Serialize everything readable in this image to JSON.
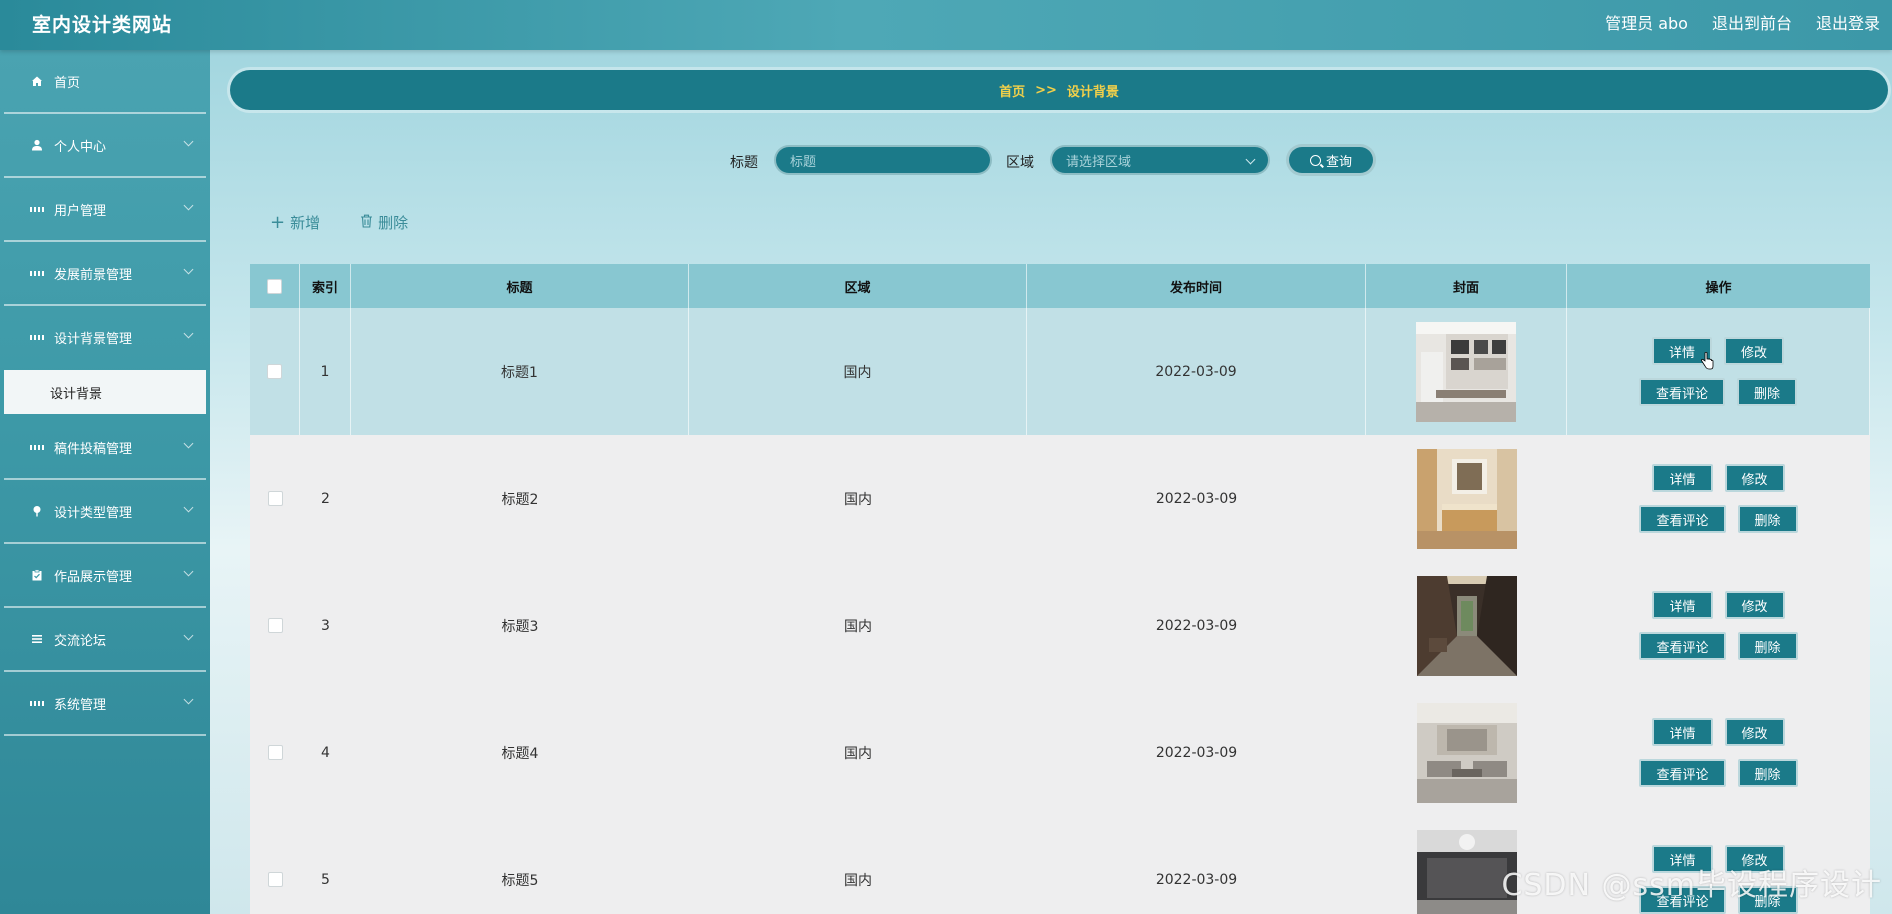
{
  "header": {
    "brand": "室内设计类网站",
    "admin": "管理员 abo",
    "to_front": "退出到前台",
    "logout": "退出登录"
  },
  "sidebar": {
    "items": [
      {
        "label": "首页",
        "icon": "home-icon"
      },
      {
        "label": "个人中心",
        "icon": "user-icon"
      },
      {
        "label": "用户管理",
        "icon": "grid-icon"
      },
      {
        "label": "发展前景管理",
        "icon": "grid-icon"
      },
      {
        "label": "设计背景管理",
        "icon": "grid-icon"
      },
      {
        "label": "稿件投稿管理",
        "icon": "grid-icon"
      },
      {
        "label": "设计类型管理",
        "icon": "pin-icon"
      },
      {
        "label": "作品展示管理",
        "icon": "clipboard-icon"
      },
      {
        "label": "交流论坛",
        "icon": "list-icon"
      },
      {
        "label": "系统管理",
        "icon": "grid-icon"
      }
    ],
    "sub_active": "设计背景"
  },
  "breadcrumb": {
    "home": "首页",
    "sep": ">>",
    "current": "设计背景"
  },
  "search": {
    "title_label": "标题",
    "title_placeholder": "标题",
    "area_label": "区域",
    "area_placeholder": "请选择区域",
    "query": "查询"
  },
  "toolbar": {
    "add": "新增",
    "delete": "删除"
  },
  "table": {
    "headers": {
      "index": "索引",
      "title": "标题",
      "area": "区域",
      "time": "发布时间",
      "cover": "封面",
      "ops": "操作"
    },
    "rows": [
      {
        "index": "1",
        "title": "标题1",
        "area": "国内",
        "time": "2022-03-09"
      },
      {
        "index": "2",
        "title": "标题2",
        "area": "国内",
        "time": "2022-03-09"
      },
      {
        "index": "3",
        "title": "标题3",
        "area": "国内",
        "time": "2022-03-09"
      },
      {
        "index": "4",
        "title": "标题4",
        "area": "国内",
        "time": "2022-03-09"
      },
      {
        "index": "5",
        "title": "标题5",
        "area": "国内",
        "time": "2022-03-09"
      }
    ],
    "ops": {
      "detail": "详情",
      "edit": "修改",
      "comments": "查看评论",
      "delete": "删除"
    }
  },
  "watermark": "CSDN @ssm毕设程序设计",
  "colors": {
    "primary": "#1b7a89",
    "header": "#4ea8b6",
    "breadcrumb_text": "#f2d04a"
  }
}
